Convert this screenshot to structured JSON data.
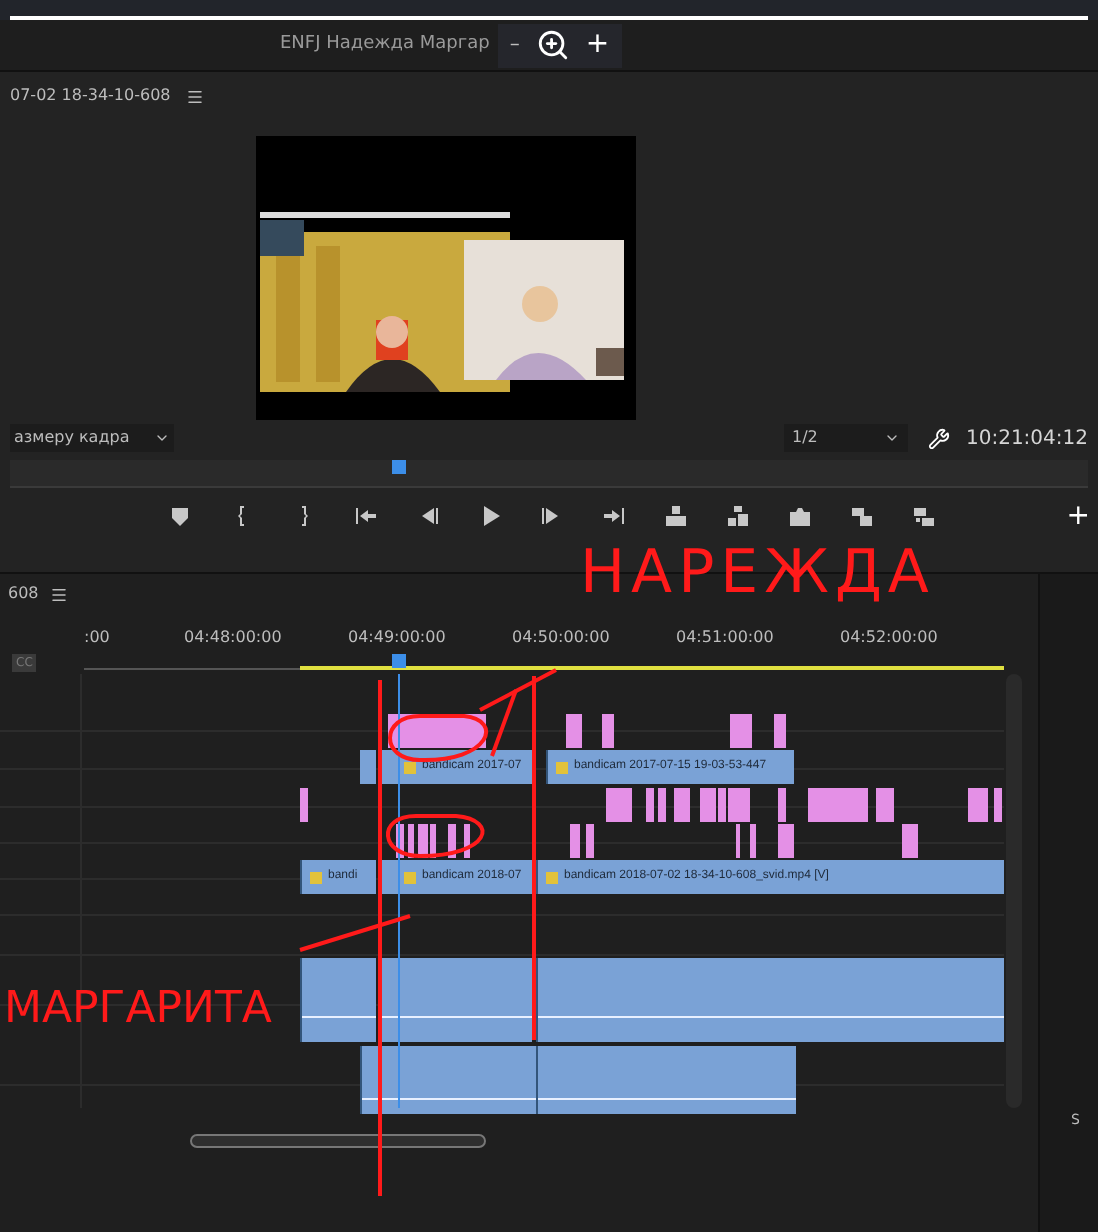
{
  "header": {
    "tab_title": "ENFJ Надежда Маргар",
    "minus": "–",
    "plus": "+"
  },
  "program_monitor": {
    "sequence_name": "07-02 18-34-10-608",
    "fit_select": "азмеру кадра",
    "resolution_select": "1/2",
    "timecode": "10:21:04:12"
  },
  "transport": {
    "add": "+"
  },
  "timeline": {
    "sequence_name": "608",
    "cc_label": "CC",
    "ruler_labels": [
      ":00",
      "04:48:00:00",
      "04:49:00:00",
      "04:50:00:00",
      "04:51:00:00",
      "04:52:00:00"
    ],
    "video_clips": [
      {
        "label": "bandicam 2017-07"
      },
      {
        "label": "bandicam 2017-07-15 19-03-53-447"
      },
      {
        "label": "bandi"
      },
      {
        "label": "bandicam 2018-07"
      },
      {
        "label": "bandicam 2018-07-02 18-34-10-608_svid.mp4 [V]"
      }
    ],
    "meter_label": "S"
  },
  "annotations": [
    {
      "text": "НАРЕЖДА"
    },
    {
      "text": "МАРГАРИТА"
    }
  ]
}
